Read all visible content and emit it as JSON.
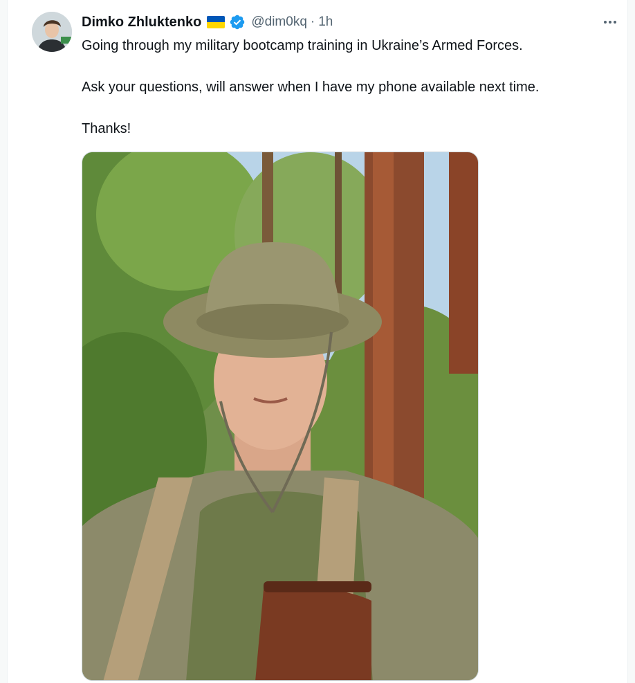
{
  "author": {
    "display_name": "Dimko Zhluktenko",
    "handle": "@dim0kq",
    "time": "1h",
    "separator": "·",
    "flag_icon": "ukraine-flag-icon",
    "badge_icon": "verified-badge-icon",
    "badge_color": "#1d9bf0"
  },
  "tweet": {
    "lines": [
      "Going through my military bootcamp training in Ukraine’s Armed Forces.",
      "Ask your questions, will answer when I have my phone available next time.",
      "Thanks!"
    ]
  },
  "more_icon": "more-options-icon",
  "colors": {
    "text": "#0f1419",
    "secondary": "#536471",
    "flag_blue": "#0057b7",
    "flag_yellow": "#ffd700"
  }
}
